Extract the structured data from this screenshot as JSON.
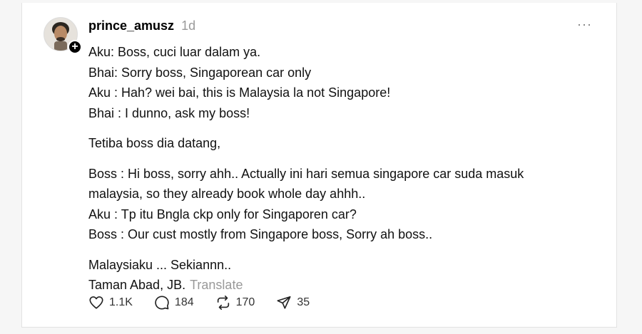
{
  "post": {
    "username": "prince_amusz",
    "time": "1d",
    "more_label": "···",
    "follow_badge": "+",
    "paragraphs": [
      [
        "Aku: Boss, cuci luar dalam ya.",
        "Bhai: Sorry boss, Singaporean car only",
        "Aku : Hah? wei bai, this is Malaysia la not Singapore!",
        "Bhai : I dunno, ask my boss!"
      ],
      [
        "Tetiba boss dia datang,"
      ],
      [
        "Boss : Hi boss, sorry ahh.. Actually ini hari semua singapore car suda masuk",
        "malaysia, so they already book whole day ahhh..",
        "Aku : Tp itu Bngla ckp only for Singaporen car?",
        "Boss : Our cust mostly from Singapore boss, Sorry ah boss.."
      ],
      [
        "Malaysiaku ... Sekiannn..",
        "Taman Abad, JB."
      ]
    ],
    "translate_label": "Translate",
    "actions": {
      "likes": "1.1K",
      "replies": "184",
      "reposts": "170",
      "shares": "35"
    }
  },
  "icons": {
    "like": "heart-icon",
    "reply": "comment-icon",
    "repost": "repost-icon",
    "share": "send-icon",
    "more": "more-options-icon"
  }
}
